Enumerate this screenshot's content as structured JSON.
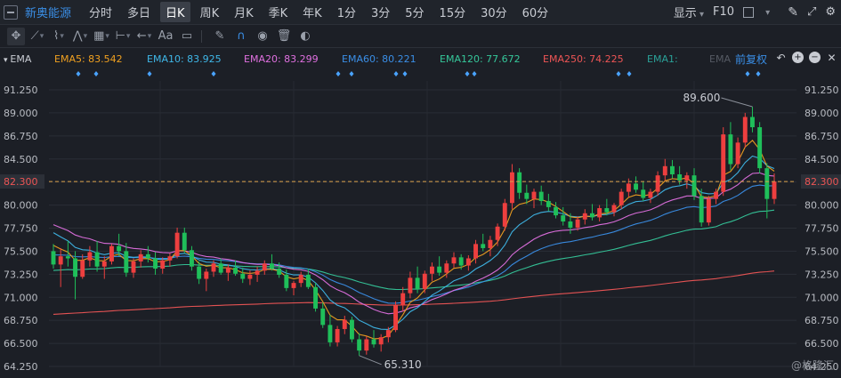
{
  "topbar": {
    "stock_name": "新奥能源",
    "periods": [
      "分时",
      "多日",
      "日K",
      "周K",
      "月K",
      "季K",
      "年K",
      "1分",
      "3分",
      "5分",
      "15分",
      "30分",
      "60分"
    ],
    "active_period": "日K",
    "display_label": "显示",
    "f10_label": "F10"
  },
  "toolbar": {
    "tools": [
      "move-icon",
      "line-icon",
      "ray-icon",
      "wave-icon",
      "fib-icon",
      "measure-icon",
      "arrow-icon",
      "text-icon",
      "comment-icon",
      "pen-icon",
      "magnet-icon",
      "eye-icon",
      "trash-icon",
      "toggle-icon"
    ],
    "text_tool_label": "Aa"
  },
  "indicator": {
    "name": "EMA",
    "items": [
      {
        "label": "EMA5: 83.542",
        "color": "#f0a020"
      },
      {
        "label": "EMA10: 83.925",
        "color": "#3fb7e8"
      },
      {
        "label": "EMA20: 83.299",
        "color": "#e070e0"
      },
      {
        "label": "EMA60: 80.221",
        "color": "#3a8ee6"
      },
      {
        "label": "EMA120: 77.672",
        "color": "#35c79a"
      },
      {
        "label": "EMA250: 74.225",
        "color": "#ee5555"
      },
      {
        "label": "EMA1:",
        "color": "#2aa198"
      },
      {
        "label": "EMA",
        "color": "#555a63"
      }
    ],
    "adjust_label": "前复权"
  },
  "chart_data": {
    "type": "candlestick",
    "y_ticks": [
      "91.250",
      "89.000",
      "86.750",
      "84.500",
      "82.250",
      "80.000",
      "77.750",
      "75.500",
      "73.250",
      "71.000",
      "68.750",
      "66.500",
      "64.250"
    ],
    "ylim": [
      64.25,
      91.25
    ],
    "current_price": "82.300",
    "high_label": "89.600",
    "low_label": "65.310",
    "colors": {
      "up": "#ee3f3f",
      "down": "#1fbf5a",
      "ema5": "#f0a020",
      "ema10": "#3fb7e8",
      "ema20": "#e070e0",
      "ema60": "#3a8ee6",
      "ema120": "#35c79a",
      "ema250": "#ee5555"
    },
    "candles": [
      [
        75.5,
        76.2,
        73.8,
        74.2
      ],
      [
        74.2,
        75.8,
        72.0,
        75.0
      ],
      [
        75.0,
        76.5,
        74.0,
        74.8
      ],
      [
        74.8,
        75.5,
        70.8,
        73.0
      ],
      [
        73.0,
        75.2,
        72.8,
        74.6
      ],
      [
        74.6,
        76.0,
        74.0,
        75.4
      ],
      [
        75.4,
        76.5,
        73.5,
        74.0
      ],
      [
        74.0,
        75.0,
        72.8,
        74.5
      ],
      [
        74.5,
        76.2,
        74.2,
        76.0
      ],
      [
        76.0,
        77.2,
        75.0,
        75.5
      ],
      [
        75.5,
        76.3,
        73.0,
        73.4
      ],
      [
        73.4,
        74.8,
        72.9,
        74.5
      ],
      [
        74.5,
        75.6,
        73.9,
        75.2
      ],
      [
        75.2,
        76.0,
        74.4,
        74.8
      ],
      [
        74.8,
        75.4,
        73.2,
        73.8
      ],
      [
        73.8,
        74.9,
        73.3,
        74.6
      ],
      [
        74.6,
        75.3,
        74.0,
        75.0
      ],
      [
        75.0,
        77.8,
        74.8,
        77.3
      ],
      [
        77.3,
        77.8,
        75.3,
        75.6
      ],
      [
        75.6,
        76.0,
        73.6,
        74.0
      ],
      [
        74.0,
        74.5,
        72.3,
        72.8
      ],
      [
        72.8,
        73.8,
        71.6,
        73.5
      ],
      [
        73.5,
        74.6,
        73.0,
        74.3
      ],
      [
        74.3,
        74.8,
        73.2,
        73.4
      ],
      [
        73.4,
        74.2,
        72.6,
        73.9
      ],
      [
        73.9,
        74.6,
        73.1,
        73.3
      ],
      [
        73.3,
        73.9,
        72.4,
        72.8
      ],
      [
        72.8,
        73.6,
        72.2,
        73.2
      ],
      [
        73.2,
        74.0,
        72.5,
        73.6
      ],
      [
        73.6,
        74.6,
        73.2,
        74.3
      ],
      [
        74.3,
        75.2,
        73.6,
        73.8
      ],
      [
        73.8,
        74.4,
        72.9,
        73.2
      ],
      [
        73.2,
        73.7,
        71.6,
        71.9
      ],
      [
        71.9,
        72.6,
        71.2,
        72.4
      ],
      [
        72.4,
        73.5,
        72.0,
        73.2
      ],
      [
        73.2,
        73.8,
        71.8,
        72.0
      ],
      [
        72.0,
        72.4,
        69.6,
        69.9
      ],
      [
        69.9,
        70.5,
        68.0,
        68.3
      ],
      [
        68.3,
        69.3,
        66.2,
        66.6
      ],
      [
        66.6,
        68.2,
        66.2,
        67.9
      ],
      [
        67.9,
        69.2,
        67.4,
        68.8
      ],
      [
        68.8,
        69.1,
        66.6,
        66.9
      ],
      [
        66.9,
        67.5,
        65.31,
        65.8
      ],
      [
        65.8,
        67.2,
        65.4,
        66.9
      ],
      [
        66.9,
        67.8,
        66.1,
        66.4
      ],
      [
        66.4,
        67.4,
        65.7,
        67.1
      ],
      [
        67.1,
        68.1,
        66.6,
        67.8
      ],
      [
        67.8,
        70.6,
        67.6,
        70.2
      ],
      [
        70.2,
        72.0,
        69.6,
        71.4
      ],
      [
        71.4,
        73.5,
        70.9,
        72.9
      ],
      [
        72.9,
        74.0,
        71.4,
        71.8
      ],
      [
        71.8,
        73.6,
        71.4,
        73.3
      ],
      [
        73.3,
        74.4,
        72.6,
        74.0
      ],
      [
        74.0,
        75.0,
        73.1,
        73.4
      ],
      [
        73.4,
        74.6,
        72.9,
        74.3
      ],
      [
        74.3,
        75.4,
        73.9,
        74.9
      ],
      [
        74.9,
        75.2,
        73.7,
        74.1
      ],
      [
        74.1,
        75.1,
        73.6,
        74.8
      ],
      [
        74.8,
        76.6,
        74.3,
        76.2
      ],
      [
        76.2,
        77.2,
        75.5,
        75.8
      ],
      [
        75.8,
        77.0,
        75.0,
        76.6
      ],
      [
        76.6,
        78.2,
        76.0,
        77.9
      ],
      [
        77.9,
        80.6,
        77.5,
        80.2
      ],
      [
        80.2,
        84.0,
        79.6,
        83.2
      ],
      [
        83.2,
        83.6,
        80.6,
        81.2
      ],
      [
        81.2,
        82.0,
        80.1,
        80.6
      ],
      [
        80.6,
        81.6,
        79.7,
        81.3
      ],
      [
        81.3,
        81.9,
        80.0,
        80.4
      ],
      [
        80.4,
        81.1,
        79.4,
        79.8
      ],
      [
        79.8,
        80.3,
        78.7,
        79.0
      ],
      [
        79.0,
        79.8,
        78.0,
        78.4
      ],
      [
        78.4,
        79.2,
        77.2,
        77.8
      ],
      [
        77.8,
        78.9,
        77.5,
        78.6
      ],
      [
        78.6,
        79.6,
        78.1,
        79.2
      ],
      [
        79.2,
        80.1,
        78.5,
        78.8
      ],
      [
        78.8,
        80.0,
        78.4,
        79.7
      ],
      [
        79.7,
        80.6,
        79.0,
        79.3
      ],
      [
        79.3,
        80.2,
        78.9,
        80.0
      ],
      [
        80.0,
        81.6,
        79.6,
        81.3
      ],
      [
        81.3,
        82.6,
        80.8,
        82.1
      ],
      [
        82.1,
        82.8,
        81.2,
        81.5
      ],
      [
        81.5,
        82.3,
        80.4,
        80.7
      ],
      [
        80.7,
        81.6,
        80.2,
        81.3
      ],
      [
        81.3,
        83.3,
        80.9,
        82.9
      ],
      [
        82.9,
        84.5,
        82.4,
        83.8
      ],
      [
        83.8,
        84.4,
        82.6,
        83.0
      ],
      [
        83.0,
        83.8,
        82.0,
        82.4
      ],
      [
        82.4,
        83.2,
        81.6,
        82.9
      ],
      [
        82.9,
        83.6,
        80.5,
        80.9
      ],
      [
        80.9,
        81.6,
        77.9,
        78.3
      ],
      [
        78.3,
        80.9,
        78.0,
        80.6
      ],
      [
        80.6,
        81.6,
        80.1,
        81.3
      ],
      [
        81.3,
        87.6,
        80.9,
        86.9
      ],
      [
        86.9,
        88.1,
        83.4,
        84.0
      ],
      [
        84.0,
        86.6,
        83.6,
        86.1
      ],
      [
        86.1,
        89.0,
        85.6,
        88.6
      ],
      [
        88.6,
        89.6,
        87.1,
        87.6
      ],
      [
        87.6,
        88.1,
        83.1,
        83.6
      ],
      [
        83.6,
        84.1,
        78.7,
        80.6
      ],
      [
        80.6,
        83.1,
        80.1,
        82.3
      ]
    ]
  },
  "watermark": "@格隆汇"
}
